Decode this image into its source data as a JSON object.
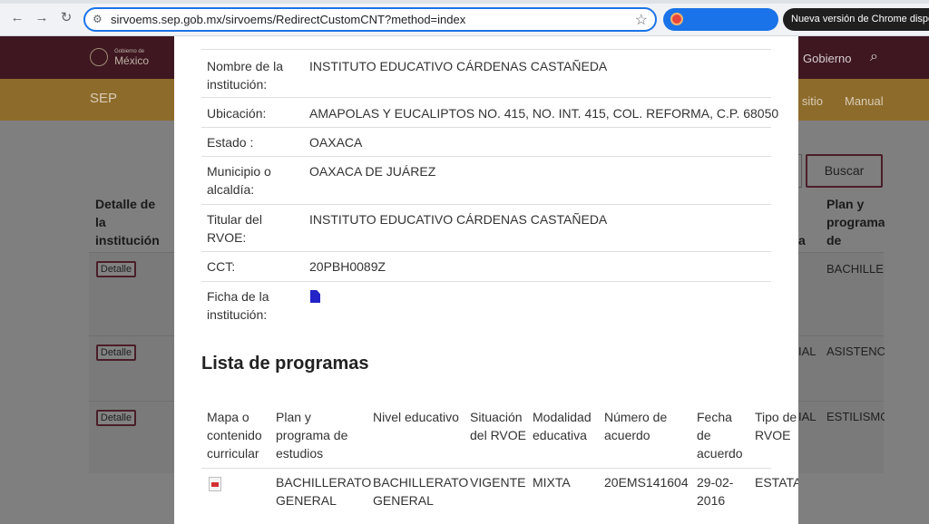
{
  "browser": {
    "url": "sirvoems.sep.gob.mx/sirvoems/RedirectCustomCNT?method=index",
    "update_text": "Nueva versión de Chrome disponible",
    "back_icon": "arrow-left-icon",
    "forward_icon": "arrow-right-icon",
    "reload_icon": "reload-icon",
    "bookmark_icon": "star-icon"
  },
  "background": {
    "logo_line1": "Gobierno de",
    "logo_line2": "México",
    "gov_link": "Gobierno",
    "sep_title": "SEP",
    "sep_links": [
      "e sitio",
      "Manual"
    ],
    "search_button": "Buscar",
    "table_headers": {
      "detalle": "Detalle de la institución",
      "col_a": "a",
      "plan": "Plan y programa de estudios"
    },
    "rows": [
      {
        "button": "Detalle",
        "mid": "",
        "plan": "BACHILLERATO GENERAL"
      },
      {
        "button": "Detalle",
        "mid": "IAL",
        "plan": "ASISTENCIA FAMILIAR Y SALUD"
      },
      {
        "button": "Detalle",
        "mid": "IAL",
        "plan": "ESTILISMO Y BIENESTAR PERSONAL"
      }
    ]
  },
  "modal": {
    "fields": [
      {
        "label": "Nombre de la institución:",
        "value": "INSTITUTO EDUCATIVO CÁRDENAS CASTAÑEDA"
      },
      {
        "label": "Ubicación:",
        "value": "AMAPOLAS Y EUCALIPTOS NO. 415, NO. INT. 415, COL. REFORMA, C.P. 68050"
      },
      {
        "label": "Estado :",
        "value": "OAXACA"
      },
      {
        "label": "Municipio o alcaldía:",
        "value": "OAXACA DE JUÁREZ"
      },
      {
        "label": "Titular del RVOE:",
        "value": "INSTITUTO EDUCATIVO CÁRDENAS CASTAÑEDA"
      },
      {
        "label": "CCT:",
        "value": "20PBH0089Z"
      },
      {
        "label": "Ficha de la institución:",
        "value": "",
        "icon": "file-icon"
      }
    ],
    "programs_title": "Lista de programas",
    "programs_headers": [
      "Mapa o contenido curricular",
      "Plan y programa de estudios",
      "Nivel educativo",
      "Situación del RVOE",
      "Modalidad educativa",
      "Número de acuerdo",
      "Fecha de acuerdo",
      "Tipo de RVOE"
    ],
    "programs_rows": [
      {
        "mapa_icon": "pdf-icon",
        "plan": "BACHILLERATO GENERAL",
        "nivel": "BACHILLERATO GENERAL",
        "situacion": "VIGENTE",
        "modalidad": "MIXTA",
        "numero": "20EMS141604",
        "fecha": "29-02-2016",
        "tipo": "ESTATAL"
      }
    ]
  }
}
